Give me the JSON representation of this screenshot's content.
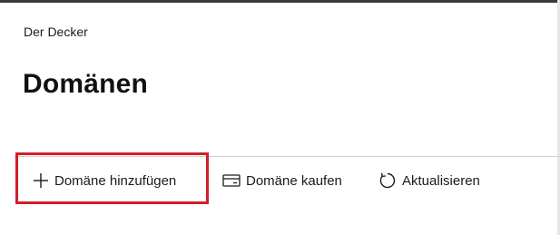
{
  "breadcrumb": "Der Decker",
  "page_title": "Domänen",
  "toolbar": {
    "add_label": "Domäne hinzufügen",
    "add_icon": "plus-icon",
    "buy_label": "Domäne kaufen",
    "buy_icon": "card-icon",
    "refresh_label": "Aktualisieren",
    "refresh_icon": "refresh-icon"
  },
  "highlight": {
    "color": "#d21f2a",
    "target": "add-domain-button"
  },
  "colors": {
    "text": "#1b1b1b",
    "top_border": "#3a3a3a",
    "divider": "#d2d2d2"
  }
}
